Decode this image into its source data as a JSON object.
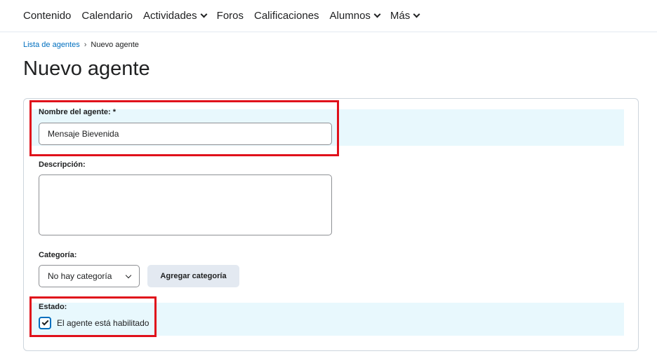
{
  "nav": {
    "items": [
      {
        "label": "Contenido",
        "dropdown": false
      },
      {
        "label": "Calendario",
        "dropdown": false
      },
      {
        "label": "Actividades",
        "dropdown": true
      },
      {
        "label": "Foros",
        "dropdown": false
      },
      {
        "label": "Calificaciones",
        "dropdown": false
      },
      {
        "label": "Alumnos",
        "dropdown": true
      },
      {
        "label": "Más",
        "dropdown": true
      }
    ]
  },
  "breadcrumb": {
    "parent": "Lista de agentes",
    "current": "Nuevo agente"
  },
  "page": {
    "title": "Nuevo agente"
  },
  "form": {
    "name_label": "Nombre del agente: *",
    "name_value": "Mensaje Bievenida",
    "description_label": "Descripción:",
    "description_value": "",
    "category_label": "Categoría:",
    "category_selected": "No hay categoría",
    "add_category_button": "Agregar categoría",
    "status_label": "Estado:",
    "enabled_label": "El agente está habilitado",
    "enabled_checked": true
  },
  "colors": {
    "link": "#006fbf",
    "highlight": "#e8f8fd",
    "annotation_red": "#e0111b",
    "button_bg": "#e3e9f1"
  }
}
